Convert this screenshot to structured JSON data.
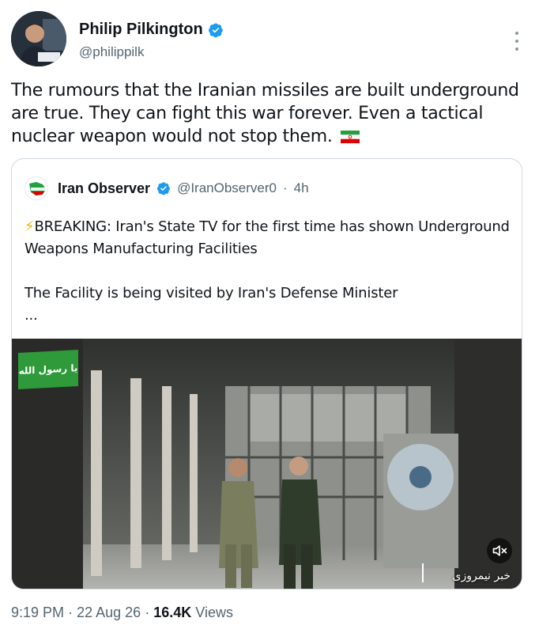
{
  "author": {
    "name": "Philip Pilkington",
    "handle": "@philippilk",
    "avatar_icon": "avatar-photo",
    "verified_color": "#1d9bf0"
  },
  "tweet": {
    "text": "The rumours that the Iranian missiles are built underground are true. They can fight this war forever. Even a tactical nuclear weapon would not stop them.",
    "flag_icon": "iran-flag-emoji"
  },
  "quoted": {
    "name": "Iran Observer",
    "handle": "@IranObserver0",
    "separator": "·",
    "time": "4h",
    "line1": "BREAKING: Iran's State TV for the first time has shown Underground Weapons Manufacturing Facilities",
    "line2": "The Facility is being visited by Iran's Defense Minister",
    "ellipsis": "...",
    "bolt_icon": "lightning-icon",
    "video": {
      "badge_text": "یا رسول الله",
      "caption_text": "خبر نیمروزی",
      "mute_icon": "mute-icon"
    }
  },
  "footer": {
    "time": "9:19 PM",
    "dot1": "·",
    "date": "22 Aug 26",
    "dot2": "·",
    "views_count": "16.4K",
    "views_label": "Views"
  }
}
